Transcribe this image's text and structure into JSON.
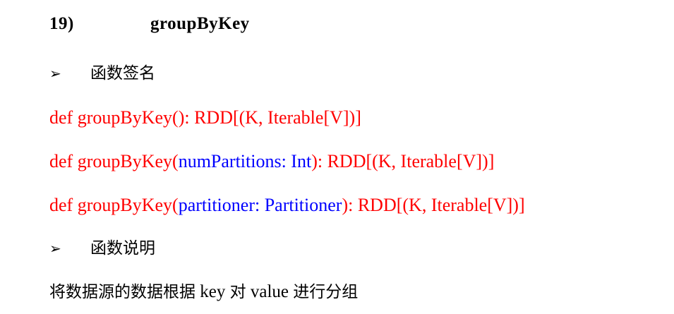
{
  "heading": {
    "number": "19)",
    "title": "groupByKey"
  },
  "section_signature": {
    "bullet": "➢",
    "label": "函数签名"
  },
  "signatures": [
    {
      "prefix": "def groupByKey(",
      "param": "",
      "suffix": "): RDD[(K, Iterable[V])]"
    },
    {
      "prefix": "def groupByKey(",
      "param": "numPartitions: Int",
      "suffix": "): RDD[(K, Iterable[V])]"
    },
    {
      "prefix": "def groupByKey(",
      "param": "partitioner: Partitioner",
      "suffix": "): RDD[(K, Iterable[V])]"
    }
  ],
  "section_description": {
    "bullet": "➢",
    "label": "函数说明"
  },
  "description": {
    "part1": "将数据源的数据根据",
    "keyword1": " key ",
    "part2": "对",
    "keyword2": " value ",
    "part3": "进行分组"
  }
}
